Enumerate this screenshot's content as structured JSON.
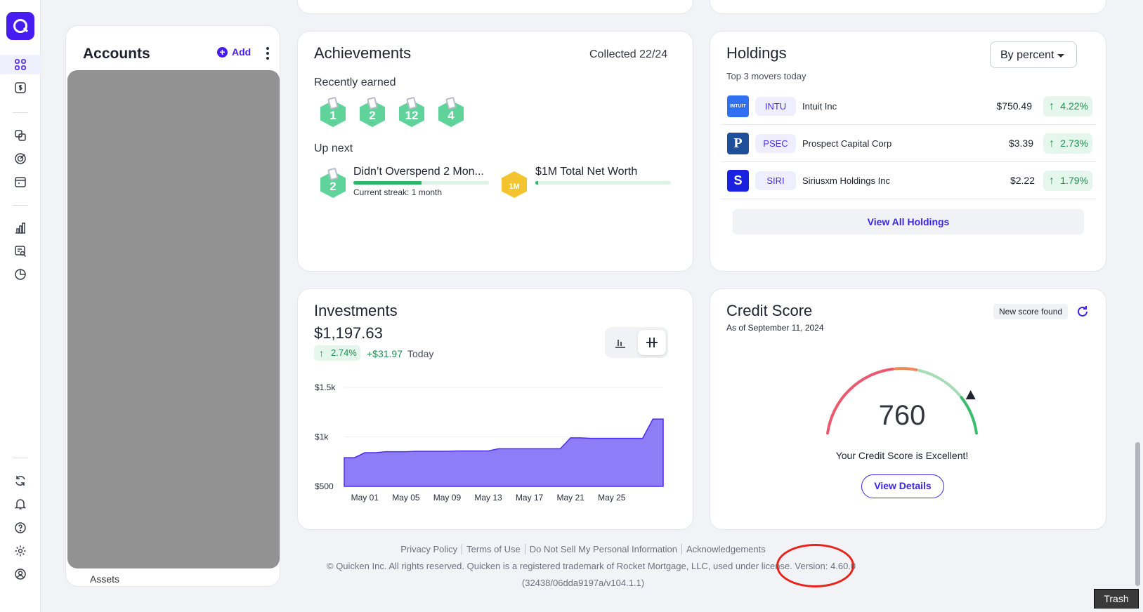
{
  "nav": {
    "items": [
      "dashboard-icon",
      "spending-icon",
      "transactions-icon",
      "goals-icon",
      "bills-icon",
      "reports-icon",
      "search-report-icon",
      "budget-pie-icon",
      "sync-icon",
      "notifications-icon",
      "help-icon",
      "settings-icon",
      "profile-icon"
    ]
  },
  "accounts": {
    "title": "Accounts",
    "add_label": "Add",
    "assets_label": "Assets"
  },
  "achievements": {
    "title": "Achievements",
    "collected": "Collected 22/24",
    "recently_earned_label": "Recently earned",
    "recent_badges": [
      "1",
      "2",
      "12",
      "4"
    ],
    "up_next_label": "Up next",
    "next": [
      {
        "title": "Didn’t Overspend 2 Mon...",
        "badge": "2",
        "detail": "Current streak: 1 month",
        "progress": 0.5
      },
      {
        "title": "$1M Total Net Worth",
        "badge": "1M",
        "detail": "",
        "progress": 0.02
      }
    ]
  },
  "holdings": {
    "title": "Holdings",
    "subtitle": "Top 3 movers today",
    "sort_selected": "By percent",
    "rows": [
      {
        "logo": "INTUIT",
        "logo_color": "#2f6ff2",
        "ticker": "INTU",
        "name": "Intuit Inc",
        "price": "$750.49",
        "change": "4.22%"
      },
      {
        "logo": "P",
        "logo_color": "#1e4f9b",
        "ticker": "PSEC",
        "name": "Prospect Capital Corp",
        "price": "$3.39",
        "change": "2.73%"
      },
      {
        "logo": "S",
        "logo_color": "#1a22e0",
        "ticker": "SIRI",
        "name": "Siriusxm Holdings Inc",
        "price": "$2.22",
        "change": "1.79%"
      }
    ],
    "view_all_label": "View All Holdings"
  },
  "investments": {
    "title": "Investments",
    "value": "$1,197.63",
    "change_pct": "2.74%",
    "change_abs": "+$31.97",
    "period": "Today"
  },
  "chart_data": {
    "type": "area",
    "title": "",
    "xlabel": "",
    "ylabel": "",
    "ylim": [
      500,
      1500
    ],
    "yticks": [
      500,
      1000,
      1500
    ],
    "ytick_labels": [
      "$500",
      "$1k",
      "$1.5k"
    ],
    "xlim": [
      -1,
      30
    ],
    "xtick_positions": [
      1,
      5,
      9,
      13,
      17,
      21,
      25
    ],
    "xtick_labels": [
      "May 01",
      "May 05",
      "May 09",
      "May 13",
      "May 17",
      "May 21",
      "May 25"
    ],
    "x": [
      -1,
      0,
      1,
      2,
      3,
      4,
      5,
      6,
      7,
      8,
      9,
      10,
      11,
      12,
      13,
      14,
      15,
      16,
      17,
      18,
      19,
      20,
      21,
      22,
      23,
      24,
      25,
      26,
      27,
      28,
      29,
      30
    ],
    "series": [
      {
        "values": [
          790,
          790,
          840,
          840,
          850,
          850,
          850,
          855,
          855,
          855,
          855,
          858,
          858,
          858,
          858,
          880,
          880,
          880,
          880,
          880,
          880,
          880,
          990,
          990,
          985,
          985,
          985,
          985,
          985,
          985,
          1180,
          1180
        ],
        "color": "#8f7cf7"
      }
    ],
    "grid": true,
    "legend": "none"
  },
  "credit_score": {
    "title": "Credit Score",
    "as_of": "As of September 11, 2024",
    "badge": "New score found",
    "score": "760",
    "score_value": 760,
    "label": "Your Credit Score is Excellent!",
    "button": "View Details"
  },
  "footer": {
    "links": [
      "Privacy Policy",
      "Terms of Use",
      "Do Not Sell My Personal Information",
      "Acknowledgements"
    ],
    "copyright": "© Quicken Inc. All rights reserved. Quicken is a registered trademark of Rocket Mortgage, LLC, used under license.",
    "version": "Version: 4.60.0",
    "build": "(32438/06dda9197a/v104.1.1)"
  },
  "trash_label": "Trash",
  "colors": {
    "brand": "#471cf0",
    "positive": "#1e8e4e",
    "annotation": "#e8231a"
  }
}
